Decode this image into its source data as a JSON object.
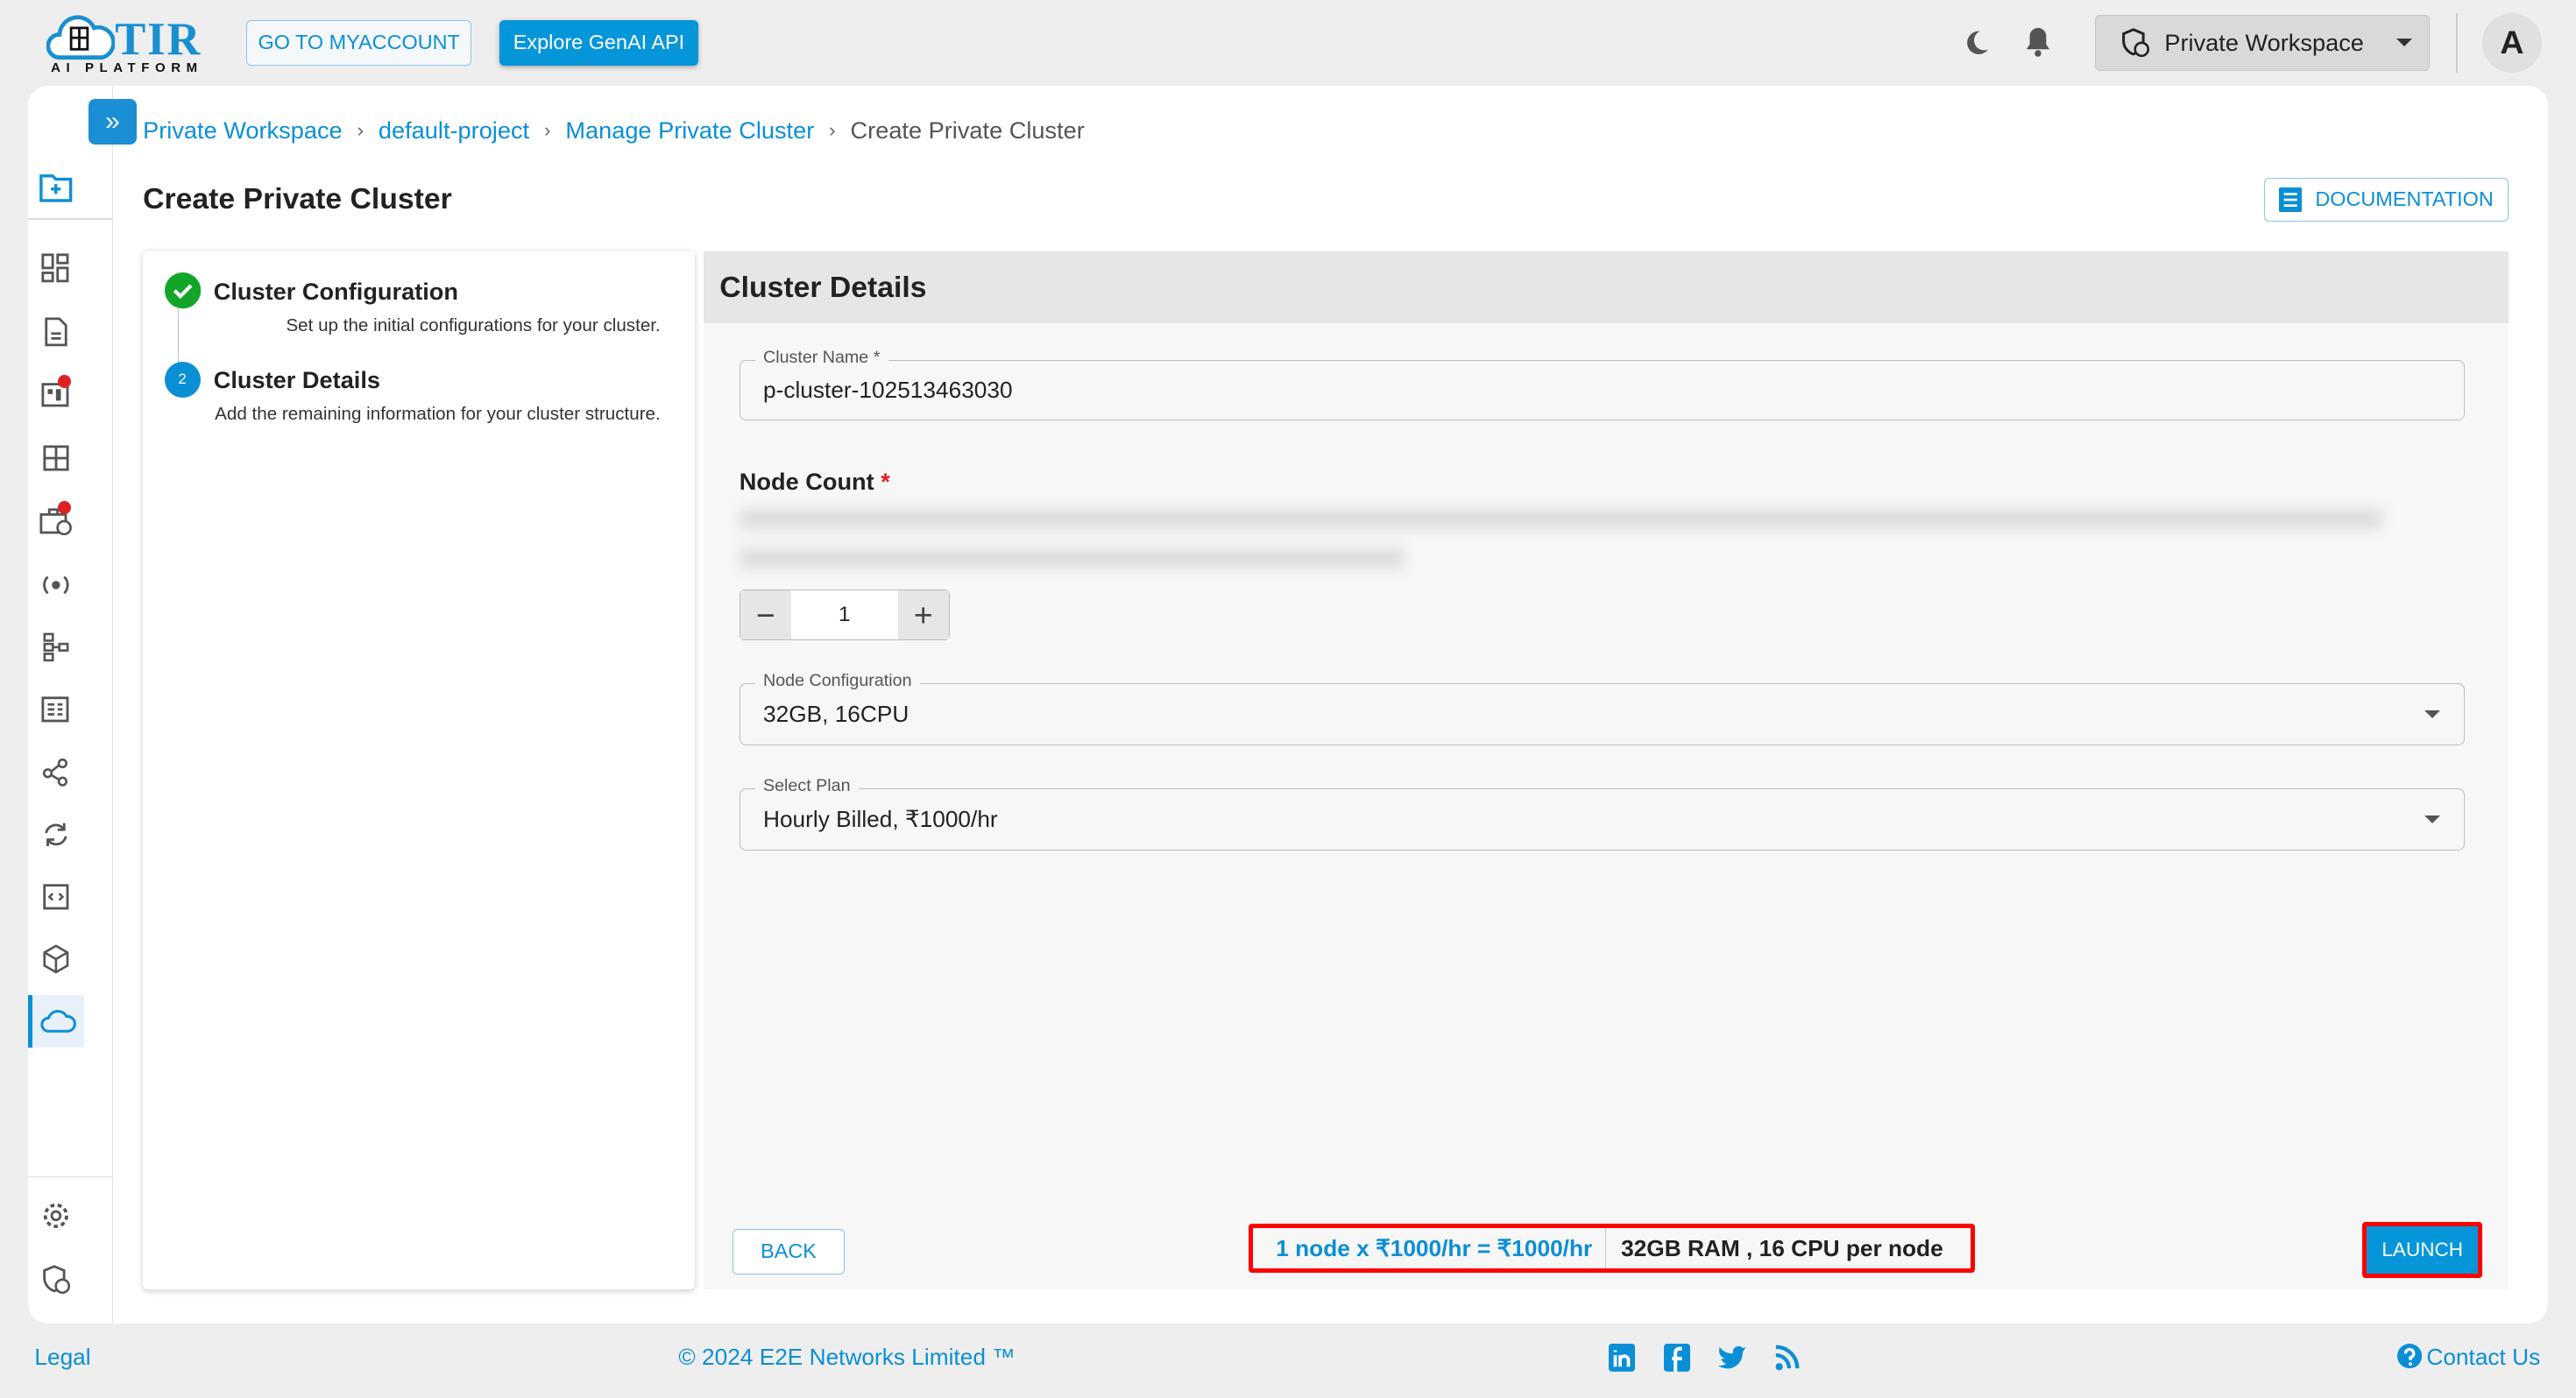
{
  "header": {
    "logo_text": "TIR",
    "logo_sub": "AI PLATFORM",
    "logo_badge": "E2E Cloud",
    "myaccount_label": "GO TO MYACCOUNT",
    "genai_label": "Explore GenAI API",
    "workspace_label": "Private Workspace",
    "avatar_initial": "A"
  },
  "breadcrumb": [
    "Private Workspace",
    "default-project",
    "Manage Private Cluster",
    "Create Private Cluster"
  ],
  "page": {
    "title": "Create Private Cluster",
    "documentation_label": "DOCUMENTATION"
  },
  "steps": [
    {
      "title": "Cluster Configuration",
      "desc": "Set up the initial configurations for your cluster.",
      "status": "complete"
    },
    {
      "number": "2",
      "title": "Cluster Details",
      "desc": "Add the remaining information for your cluster structure.",
      "status": "active"
    }
  ],
  "form": {
    "heading": "Cluster Details",
    "cluster_name_label": "Cluster Name *",
    "cluster_name_value": "p-cluster-102513463030",
    "node_count_label": "Node Count",
    "required_mark": "*",
    "node_count_value": "1",
    "node_config_label": "Node Configuration",
    "node_config_value": "32GB, 16CPU",
    "plan_label": "Select Plan",
    "plan_value": "Hourly Billed, ₹1000/hr"
  },
  "actions": {
    "back_label": "BACK",
    "cost_summary": "1 node x ₹1000/hr = ₹1000/hr",
    "spec_summary": "32GB RAM , 16 CPU per node",
    "launch_label": "LAUNCH"
  },
  "footer": {
    "legal": "Legal",
    "copyright": "© 2024 E2E Networks Limited ™",
    "contact": "Contact Us"
  },
  "colors": {
    "accent": "#0596d9",
    "success": "#12a52a",
    "highlight": "#ff0000"
  }
}
